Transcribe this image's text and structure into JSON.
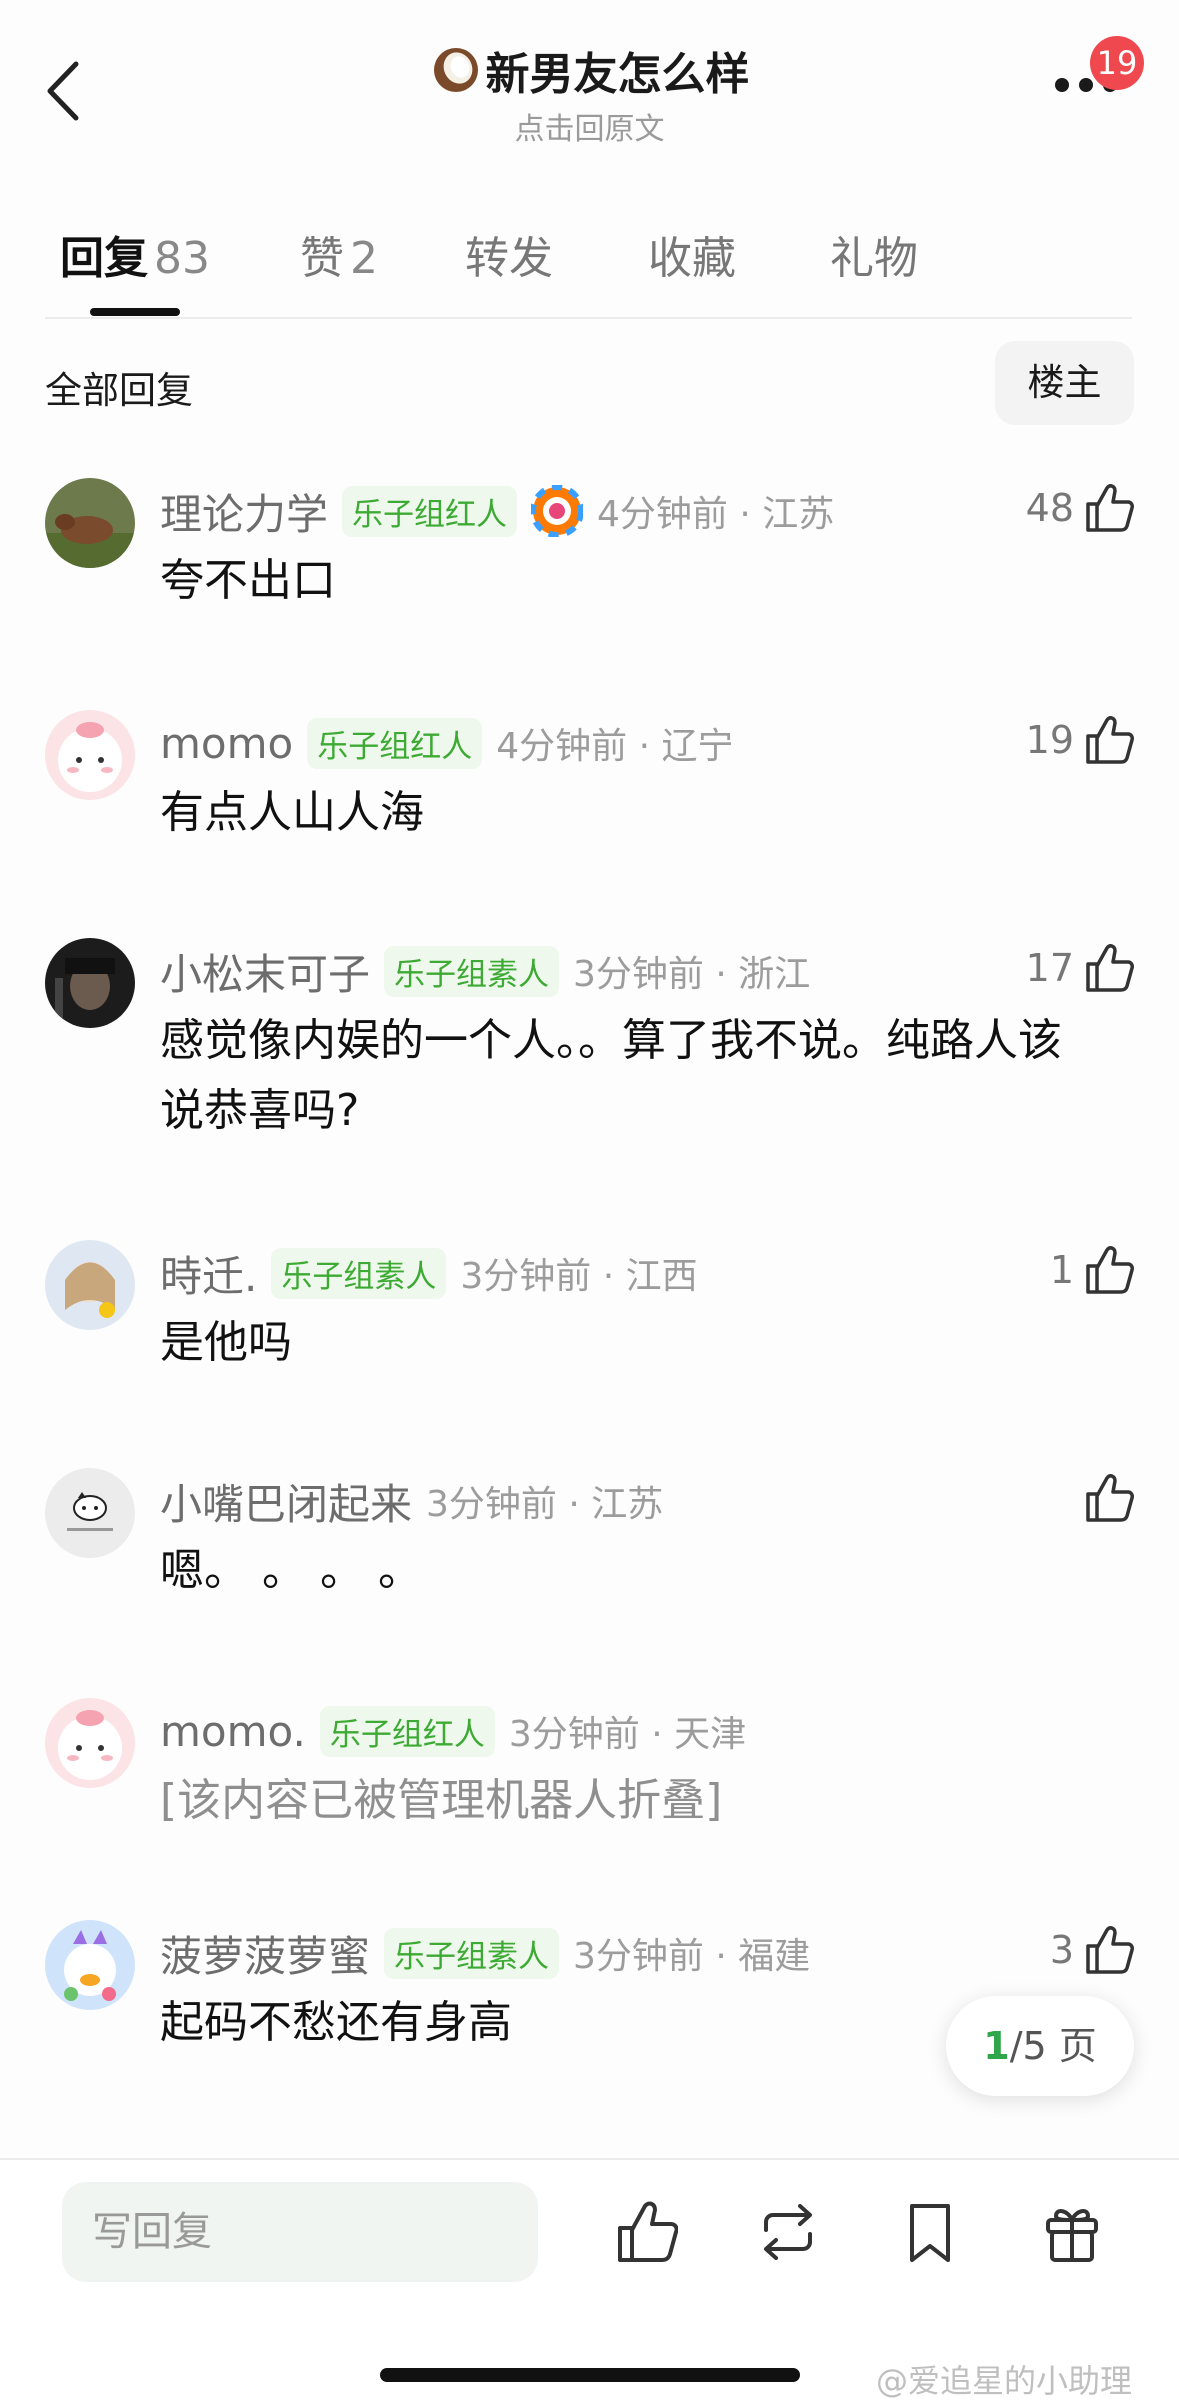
{
  "header": {
    "title": "新男友怎么样",
    "subtitle": "点击回原文",
    "badge": "19",
    "title_icon": "coconut-icon"
  },
  "tabs": [
    {
      "label": "回复",
      "count": "83",
      "active": true
    },
    {
      "label": "赞",
      "count": "2",
      "active": false
    },
    {
      "label": "转发",
      "count": "",
      "active": false
    },
    {
      "label": "收藏",
      "count": "",
      "active": false
    },
    {
      "label": "礼物",
      "count": "",
      "active": false
    }
  ],
  "filter": {
    "title": "全部回复",
    "owner_button": "楼主"
  },
  "comments": [
    {
      "name": "理论力学",
      "tag": "乐子组红人",
      "time": "4分钟前 · 江苏",
      "text": "夸不出口",
      "likes": "48"
    },
    {
      "name": "momo",
      "tag": "乐子组红人",
      "time": "4分钟前 · 辽宁",
      "text": "有点人山人海",
      "likes": "19"
    },
    {
      "name": "小松末可子",
      "tag": "乐子组素人",
      "time": "3分钟前 · 浙江",
      "text": "感觉像内娱的一个人。。算了我不说。纯路人该说恭喜吗?",
      "likes": "17"
    },
    {
      "name": "時迁.",
      "tag": "乐子组素人",
      "time": "3分钟前 · 江西",
      "text": "是他吗",
      "likes": "1"
    },
    {
      "name": "小嘴巴闭起来",
      "tag": "",
      "time": "3分钟前 · 江苏",
      "text": "嗯。 。 。 。",
      "likes": ""
    },
    {
      "name": "momo.",
      "tag": "乐子组红人",
      "time": "3分钟前 · 天津",
      "text": "[该内容已被管理机器人折叠]",
      "likes": ""
    },
    {
      "name": "菠萝菠萝蜜",
      "tag": "乐子组素人",
      "time": "3分钟前 · 福建",
      "text": "起码不愁还有身高",
      "likes": "3"
    }
  ],
  "pager": {
    "current": "1",
    "total": "/5 页"
  },
  "bottom_bar": {
    "reply_placeholder": "写回复"
  },
  "watermark": "@爱追星的小助理",
  "colors": {
    "accent_green": "#3daa34",
    "badge_red": "#f0484f"
  }
}
